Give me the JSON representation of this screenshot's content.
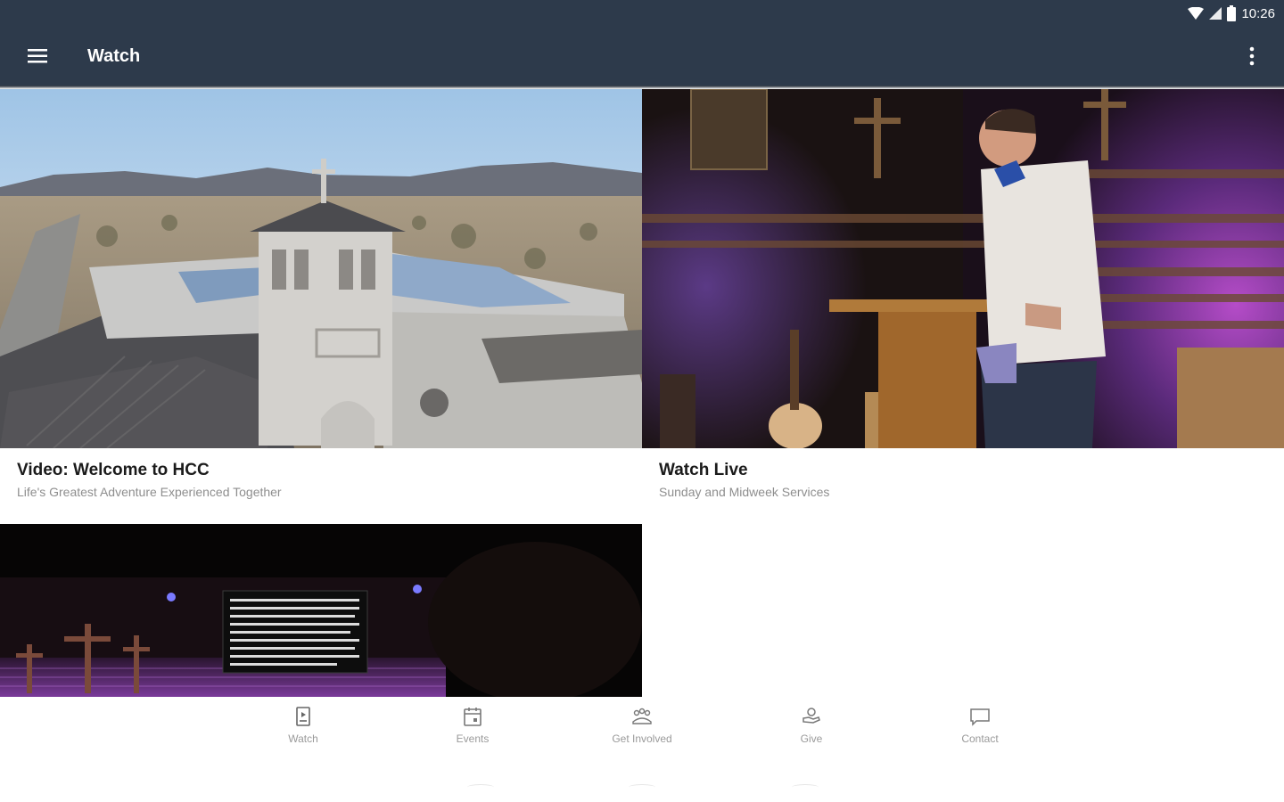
{
  "status_bar": {
    "time": "10:26",
    "icons": [
      "wifi-icon",
      "cell-signal-icon",
      "battery-icon"
    ]
  },
  "app_bar": {
    "title": "Watch",
    "menu_icon": "hamburger-menu-icon",
    "overflow_icon": "more-vert-icon",
    "background": "#2d3a4b"
  },
  "cards": [
    {
      "title": "Video: Welcome to HCC",
      "subtitle": "Life's Greatest Adventure Experienced Together",
      "image": "church-aerial-photo"
    },
    {
      "title": "Watch Live",
      "subtitle": "Sunday and Midweek Services",
      "image": "pastor-preaching-photo"
    },
    {
      "title": "",
      "subtitle": "",
      "image": "worship-stage-photo"
    }
  ],
  "stage_screen_text": "",
  "bottom_nav": {
    "items": [
      {
        "label": "Watch",
        "icon": "watch-book-icon"
      },
      {
        "label": "Events",
        "icon": "calendar-icon"
      },
      {
        "label": "Get Involved",
        "icon": "group-icon"
      },
      {
        "label": "Give",
        "icon": "give-hand-icon"
      },
      {
        "label": "Contact",
        "icon": "chat-bubble-icon"
      }
    ]
  }
}
